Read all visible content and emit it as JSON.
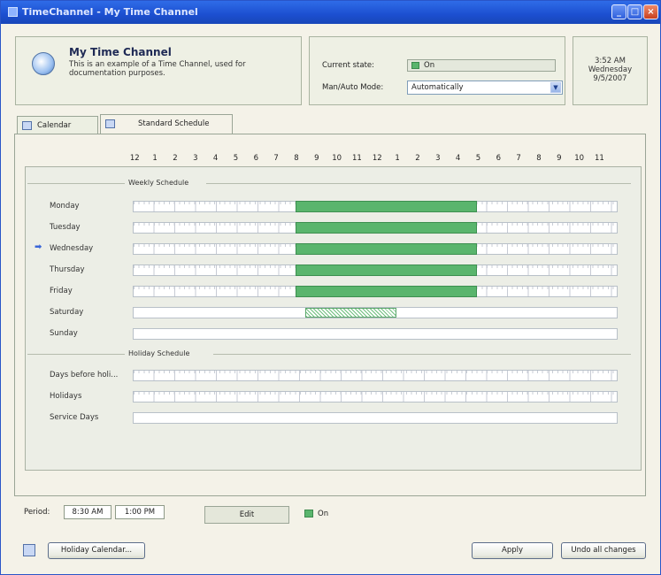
{
  "window": {
    "title": "TimeChannel - My Time Channel",
    "controls": [
      "minimize",
      "maximize",
      "close"
    ]
  },
  "info": {
    "name": "My Time Channel",
    "description": "This is an example of a Time Channel, used for documentation purposes."
  },
  "state": {
    "current_state_label": "Current state:",
    "current_state_value": "On",
    "mode_label": "Man/Auto Mode:",
    "mode_value": "Automatically"
  },
  "clock": {
    "time": "3:52 AM",
    "day": "Wednesday",
    "date": "9/5/2007"
  },
  "tabs": [
    {
      "label": "Calendar",
      "icon": "calendar-icon"
    },
    {
      "label": "Standard Schedule",
      "icon": "schedule-icon"
    }
  ],
  "hours": [
    "12",
    "1",
    "2",
    "3",
    "4",
    "5",
    "6",
    "7",
    "8",
    "9",
    "10",
    "11",
    "12",
    "1",
    "2",
    "3",
    "4",
    "5",
    "6",
    "7",
    "8",
    "9",
    "10",
    "11"
  ],
  "weekly": {
    "title": "Weekly Schedule",
    "days": [
      {
        "label": "Monday",
        "on_start": 8,
        "on_end": 17,
        "current": false
      },
      {
        "label": "Tuesday",
        "on_start": 8,
        "on_end": 17,
        "current": false
      },
      {
        "label": "Wednesday",
        "on_start": 8,
        "on_end": 17,
        "current": true
      },
      {
        "label": "Thursday",
        "on_start": 8,
        "on_end": 17,
        "current": false
      },
      {
        "label": "Friday",
        "on_start": 8,
        "on_end": 17,
        "current": false
      },
      {
        "label": "Saturday",
        "on_start": 8.5,
        "on_end": 13,
        "current": false,
        "selected": true
      },
      {
        "label": "Sunday",
        "on_start": null,
        "on_end": null,
        "current": false
      }
    ]
  },
  "holiday": {
    "title": "Holiday Schedule",
    "rows": [
      "Days before holi...",
      "Holidays",
      "Service Days"
    ]
  },
  "footer": {
    "period_label": "Period:",
    "period_start": "8:30 AM",
    "period_end": "1:00 PM",
    "edit_label": "Edit",
    "state_label": "On"
  },
  "buttons": {
    "holiday_calendar": "Holiday Calendar...",
    "apply": "Apply",
    "undo": "Undo all changes"
  },
  "colors": {
    "on": "#5ab56d",
    "titlebar": "#2457d6"
  }
}
